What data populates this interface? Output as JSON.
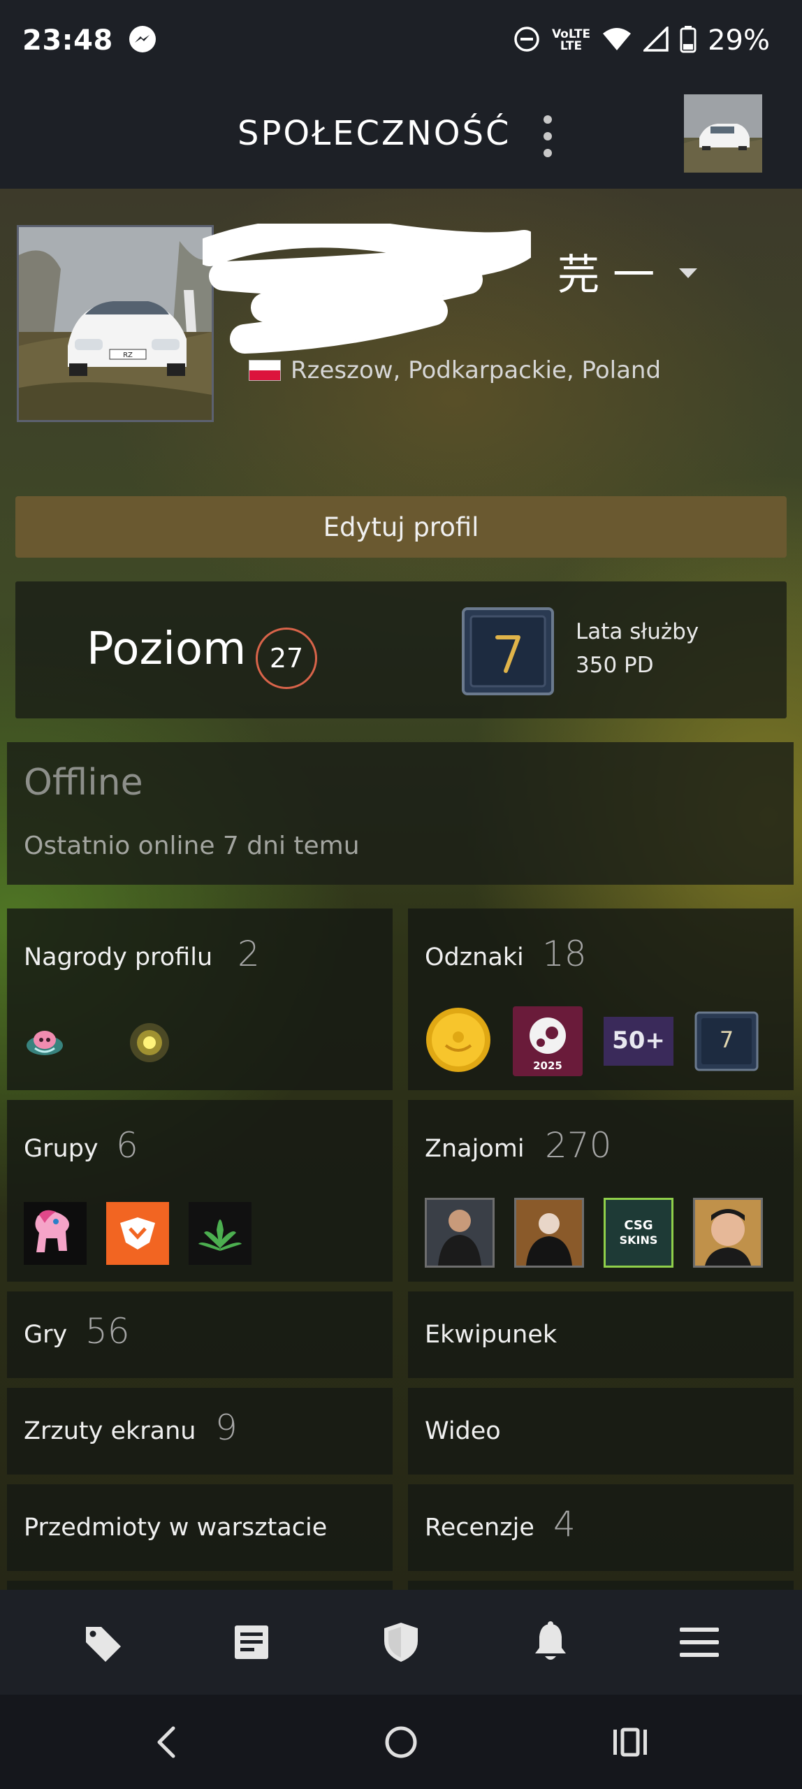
{
  "status_bar": {
    "time": "23:48",
    "network_label": "VoLTE",
    "battery": "29%"
  },
  "app_bar": {
    "title": "SPOŁECZNOŚĆ"
  },
  "profile": {
    "name_suffix": "芫 一",
    "location": "Rzeszow, Podkarpackie, Poland",
    "edit_button": "Edytuj profil",
    "level_label": "Poziom",
    "level": "27",
    "years_badge_number": "7",
    "years_title": "Lata służby",
    "years_xp": "350 PD",
    "status": "Offline",
    "last_online": "Ostatnio online 7 dni temu"
  },
  "sections": {
    "profile_rewards": {
      "label": "Nagrody profilu",
      "count": "2"
    },
    "badges": {
      "label": "Odznaki",
      "count": "18",
      "badge_year": "2025",
      "badge_fifty": "50+",
      "badge_years": "7"
    },
    "groups": {
      "label": "Grupy",
      "count": "6"
    },
    "friends": {
      "label": "Znajomi",
      "count": "270",
      "friend_csg_text1": "CSG",
      "friend_csg_text2": "SKINS"
    },
    "games": {
      "label": "Gry",
      "count": "56"
    },
    "inventory": {
      "label": "Ekwipunek"
    },
    "screenshots": {
      "label": "Zrzuty ekranu",
      "count": "9"
    },
    "videos": {
      "label": "Wideo"
    },
    "workshop": {
      "label": "Przedmioty w warsztacie"
    },
    "reviews": {
      "label": "Recenzje",
      "count": "4"
    }
  },
  "colors": {
    "level_ring": "#d9644a",
    "edit_button": "#6a5930",
    "app_bar": "#1d2026"
  }
}
